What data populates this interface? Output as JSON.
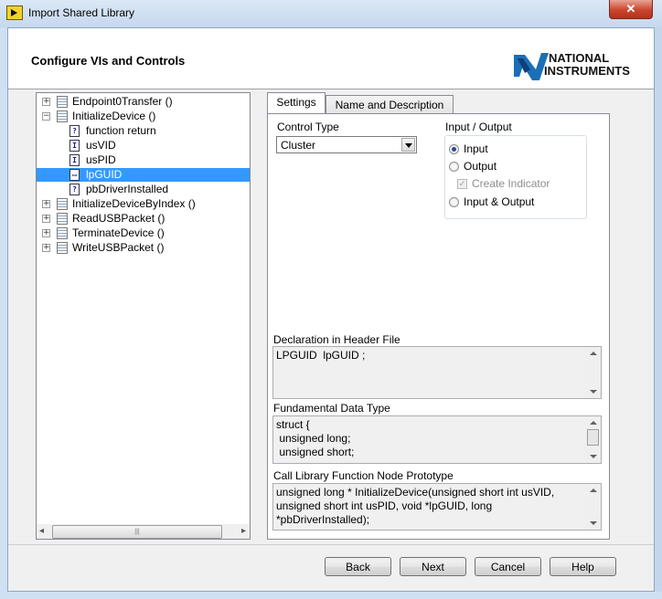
{
  "window": {
    "title": "Import Shared Library",
    "close_glyph": "✕"
  },
  "header": {
    "title": "Configure VIs and Controls",
    "logo_line1": "NATIONAL",
    "logo_line2": "INSTRUMENTS"
  },
  "tree": {
    "items": [
      {
        "label": "Endpoint0Transfer ()",
        "expand": "+"
      },
      {
        "label": "InitializeDevice ()",
        "expand": "−"
      },
      {
        "label": "function return",
        "icon_glyph": "?"
      },
      {
        "label": "usVID",
        "icon_glyph": "I"
      },
      {
        "label": "usPID",
        "icon_glyph": "I"
      },
      {
        "label": "lpGUID",
        "icon_glyph": "▭"
      },
      {
        "label": "pbDriverInstalled",
        "icon_glyph": "?"
      },
      {
        "label": "InitializeDeviceByIndex ()",
        "expand": "+"
      },
      {
        "label": "ReadUSBPacket ()",
        "expand": "+"
      },
      {
        "label": "TerminateDevice ()",
        "expand": "+"
      },
      {
        "label": "WriteUSBPacket ()",
        "expand": "+"
      }
    ],
    "hscroll_left": "◂",
    "hscroll_right": "▸",
    "hscroll_grip": "|||"
  },
  "tabs": [
    {
      "label": "Settings"
    },
    {
      "label": "Name and Description"
    }
  ],
  "settings": {
    "control_type_label": "Control Type",
    "control_type_value": "Cluster",
    "io_label": "Input / Output",
    "radio_input": "Input",
    "radio_output": "Output",
    "create_indicator": "Create Indicator",
    "radio_input_output": "Input & Output",
    "declaration_label": "Declaration in Header File",
    "declaration_value": "LPGUID  lpGUID ;",
    "fundamental_label": "Fundamental Data Type",
    "fundamental_value": "struct {\n unsigned long;\n unsigned short;",
    "prototype_label": "Call Library Function Node Prototype",
    "prototype_value": "unsigned long * InitializeDevice(unsigned short int usVID,\nunsigned short int usPID, void *lpGUID, long\n*pbDriverInstalled);"
  },
  "buttons": {
    "back": "Back",
    "next": "Next",
    "cancel": "Cancel",
    "help": "Help"
  }
}
